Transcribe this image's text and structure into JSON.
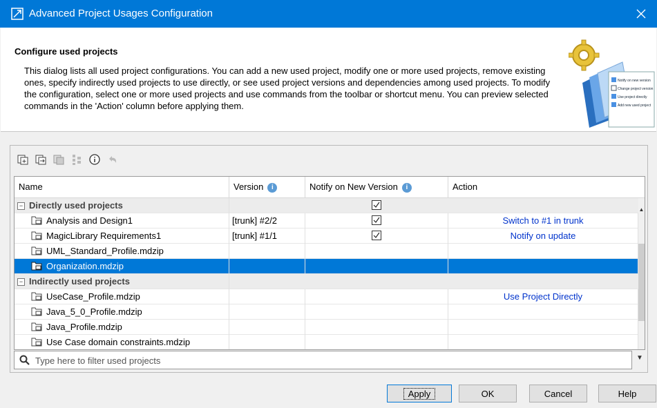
{
  "window": {
    "title": "Advanced Project Usages Configuration"
  },
  "header": {
    "title": "Configure used projects",
    "description": "This dialog lists all used project configurations. You can add a new used project, modify one or more used projects, remove existing ones, specify indirectly used projects to use directly, or see used project versions and dependencies among used projects. To modify the configuration, select one or more used projects and use commands from the toolbar or shortcut menu. You can preview selected commands in the 'Action' column before applying them.",
    "art_checklist": [
      "Notify on new version",
      "Change project version",
      "Use project directly",
      "Add new used project"
    ]
  },
  "toolbar": {
    "icons": [
      "add-project-icon",
      "change-version-icon",
      "remove-project-icon",
      "dependencies-icon",
      "info-icon",
      "undo-icon"
    ]
  },
  "table": {
    "columns": [
      "Name",
      "Version",
      "Notify on New Version",
      "Action"
    ],
    "groups": [
      {
        "label": "Directly used projects",
        "notify": true,
        "rows": [
          {
            "name": "Analysis and Design1",
            "version": "[trunk] #2/2",
            "notify": true,
            "action": "Switch to #1 in trunk"
          },
          {
            "name": "MagicLibrary Requirements1",
            "version": "[trunk] #1/1",
            "notify": true,
            "action": "Notify on update"
          },
          {
            "name": "UML_Standard_Profile.mdzip",
            "version": "",
            "notify": false,
            "action": ""
          },
          {
            "name": "Organization.mdzip",
            "version": "",
            "notify": false,
            "action": "",
            "selected": true
          }
        ]
      },
      {
        "label": "Indirectly used projects",
        "rows": [
          {
            "name": "UseCase_Profile.mdzip",
            "version": "",
            "notify": false,
            "action": "Use Project Directly"
          },
          {
            "name": "Java_5_0_Profile.mdzip",
            "version": "",
            "notify": false,
            "action": ""
          },
          {
            "name": "Java_Profile.mdzip",
            "version": "",
            "notify": false,
            "action": ""
          },
          {
            "name": "Use Case domain constraints.mdzip",
            "version": "",
            "notify": false,
            "action": ""
          }
        ]
      }
    ]
  },
  "filter": {
    "placeholder": "Type here to filter used projects",
    "value": ""
  },
  "buttons": {
    "apply": "Apply",
    "ok": "OK",
    "cancel": "Cancel",
    "help": "Help"
  },
  "colors": {
    "titlebar": "#0078d7",
    "selection": "#0078d7",
    "action_link": "#0033cc"
  }
}
